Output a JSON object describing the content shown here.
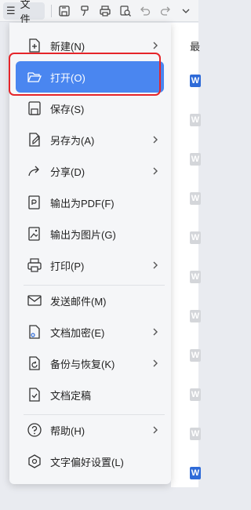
{
  "toolbar": {
    "file_label": "文件"
  },
  "background": {
    "header_char": "最",
    "word_icon_letter": "W"
  },
  "menu": {
    "new": "新建(N)",
    "open": "打开(O)",
    "save": "保存(S)",
    "save_as": "另存为(A)",
    "share": "分享(D)",
    "export_pdf": "输出为PDF(F)",
    "export_image": "输出为图片(G)",
    "print": "打印(P)",
    "send_email": "发送邮件(M)",
    "encrypt": "文档加密(E)",
    "backup": "备份与恢复(K)",
    "finalize": "文档定稿",
    "help": "帮助(H)",
    "font_pref": "文字偏好设置(L)"
  },
  "colors": {
    "active": "#4a86f0",
    "highlight_border": "#e5252a",
    "word_blue": "#2f6bd8"
  }
}
